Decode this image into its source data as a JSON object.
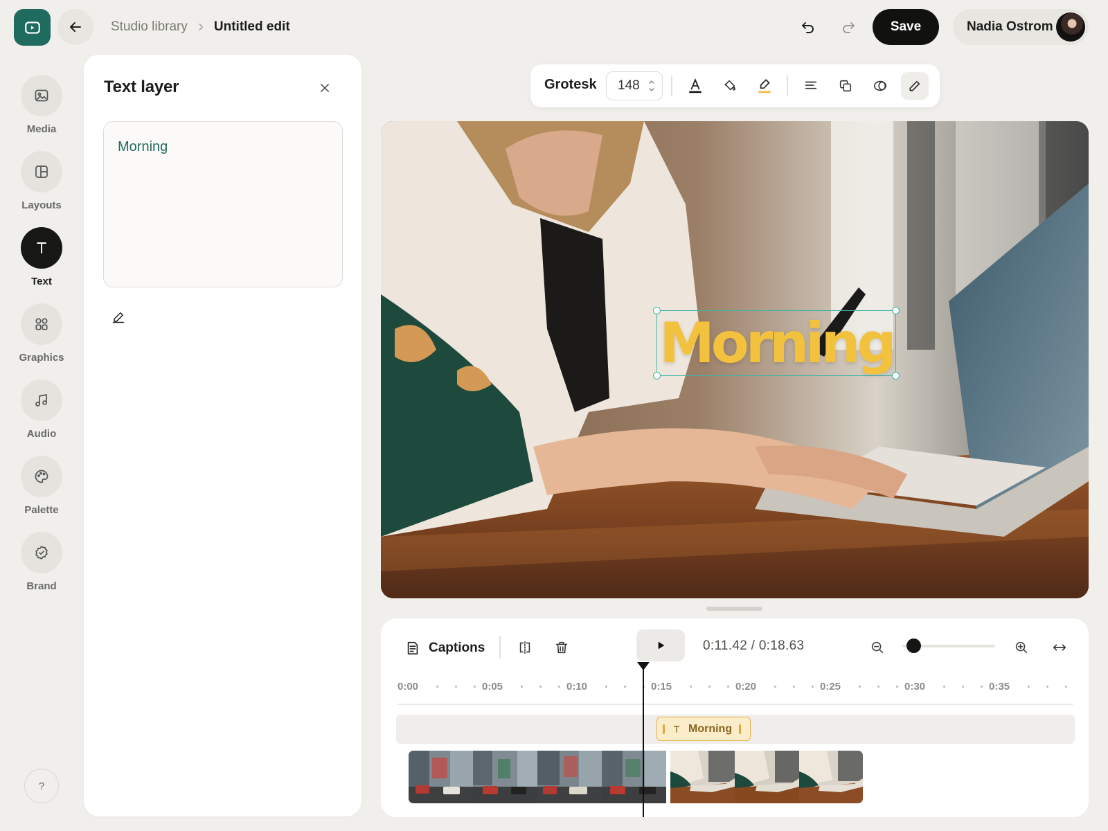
{
  "topbar": {
    "logo_icon": "play-square-icon",
    "back_icon": "arrow-left-icon",
    "breadcrumb": {
      "parent": "Studio library",
      "current": "Untitled edit"
    },
    "undo_icon": "undo-icon",
    "redo_icon": "redo-icon",
    "save_label": "Save",
    "user_name": "Nadia Ostrom"
  },
  "rail": {
    "items": [
      {
        "label": "Media",
        "icon": "image-icon"
      },
      {
        "label": "Layouts",
        "icon": "layout-icon"
      },
      {
        "label": "Text",
        "icon": "text-t-icon",
        "active": true
      },
      {
        "label": "Graphics",
        "icon": "shapes-icon"
      },
      {
        "label": "Audio",
        "icon": "music-note-icon"
      },
      {
        "label": "Palette",
        "icon": "palette-icon"
      },
      {
        "label": "Brand",
        "icon": "badge-check-icon"
      }
    ],
    "help_label": "?"
  },
  "panel": {
    "title": "Text layer",
    "text_value": "Morning"
  },
  "toolbar": {
    "font": "Grotesk",
    "size": "148",
    "highlight_color": "#f2b740"
  },
  "canvas": {
    "overlay_text": "Morning",
    "overlay_color": "#f2c23e",
    "selection_color": "#3fb3a4"
  },
  "timeline": {
    "captions_label": "Captions",
    "time_current": "0:11.42",
    "time_total": "0:18.63",
    "time_display": "0:11.42 / 0:18.63",
    "ruler_labels": [
      "0:00",
      "0:05",
      "0:10",
      "0:15",
      "0:20",
      "0:25",
      "0:30",
      "0:35"
    ],
    "zoom_level": 0.05,
    "clip_label": "Morning",
    "clip_start_s": 14.7,
    "clip_end_s": 20.2,
    "accent": "#e6b24a"
  }
}
